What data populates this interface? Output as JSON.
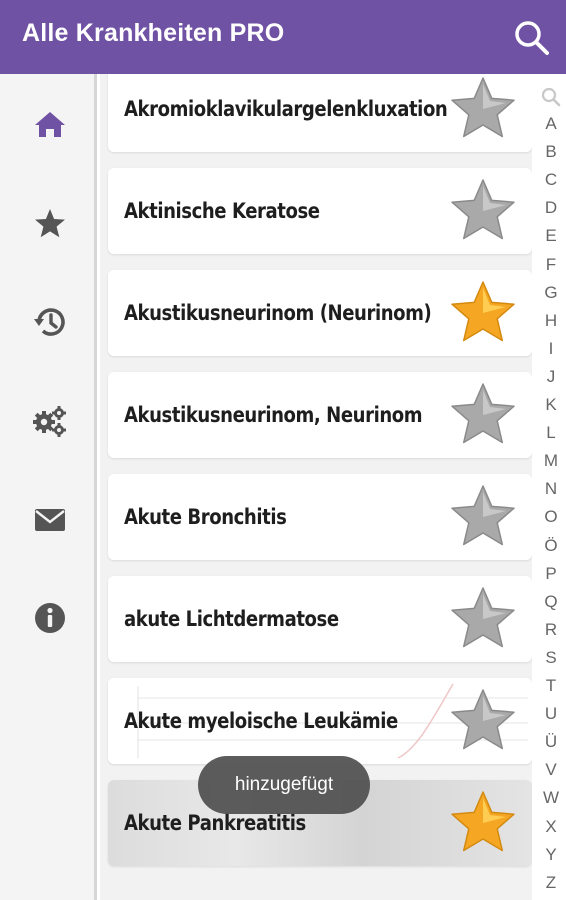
{
  "app": {
    "title": "Alle Krankheiten PRO"
  },
  "colors": {
    "appbar": "#6f52a4",
    "active_nav": "#6f52a4",
    "nav_icon": "#555555",
    "star_gold": "#f5a623",
    "star_gray": "#a9a9a9"
  },
  "sidebar": {
    "items": [
      {
        "icon": "home-icon",
        "active": true
      },
      {
        "icon": "star-icon",
        "active": false
      },
      {
        "icon": "history-icon",
        "active": false
      },
      {
        "icon": "settings-icon",
        "active": false
      },
      {
        "icon": "mail-icon",
        "active": false
      },
      {
        "icon": "info-icon",
        "active": false
      }
    ]
  },
  "list": {
    "items": [
      {
        "label": "Akromioklavikulargelenkluxation",
        "favorite": false
      },
      {
        "label": "Aktinische Keratose",
        "favorite": false
      },
      {
        "label": "Akustikusneurinom (Neurinom)",
        "favorite": true
      },
      {
        "label": "Akustikusneurinom, Neurinom",
        "favorite": false
      },
      {
        "label": "Akute Bronchitis",
        "favorite": false
      },
      {
        "label": "akute Lichtdermatose",
        "favorite": false
      },
      {
        "label": "Akute myeloische Leukämie",
        "favorite": false
      },
      {
        "label": "Akute Pankreatitis",
        "favorite": true
      }
    ]
  },
  "alphabet": [
    "A",
    "B",
    "C",
    "D",
    "E",
    "F",
    "G",
    "H",
    "I",
    "J",
    "K",
    "L",
    "M",
    "N",
    "O",
    "Ö",
    "P",
    "Q",
    "R",
    "S",
    "T",
    "U",
    "Ü",
    "V",
    "W",
    "X",
    "Y",
    "Z"
  ],
  "toast": {
    "text": "hinzugefügt"
  }
}
